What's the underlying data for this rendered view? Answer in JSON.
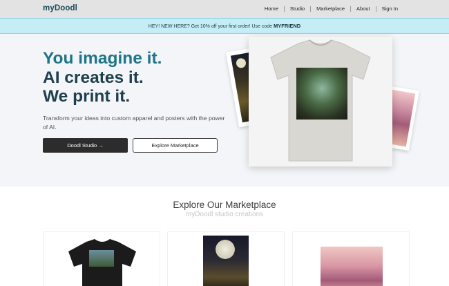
{
  "header": {
    "brand": "myDoodl",
    "nav": [
      {
        "label": "Home"
      },
      {
        "label": "Studio"
      },
      {
        "label": "Marketplace"
      },
      {
        "label": "About"
      },
      {
        "label": "Sign In"
      }
    ]
  },
  "promo": {
    "text": "HEY! NEW HERE? Get 10% off your first order! Use code ",
    "code": "MYFRIEND"
  },
  "hero": {
    "headline": [
      "You imagine it.",
      "AI creates it.",
      "We print it."
    ],
    "subtext": "Transform your ideas into custom apparel and posters with the power of AI.",
    "primary_button": "Doodl Studio →",
    "secondary_button": "Explore Marketplace"
  },
  "marketplace": {
    "title": "Explore Our Marketplace",
    "subtitle": "myDoodl studio creations"
  },
  "colors": {
    "brand": "#1a4a5a",
    "accent_teal": "#1e7588",
    "promo_bg": "#c4edf6",
    "dark_button": "#2c2c2c"
  }
}
